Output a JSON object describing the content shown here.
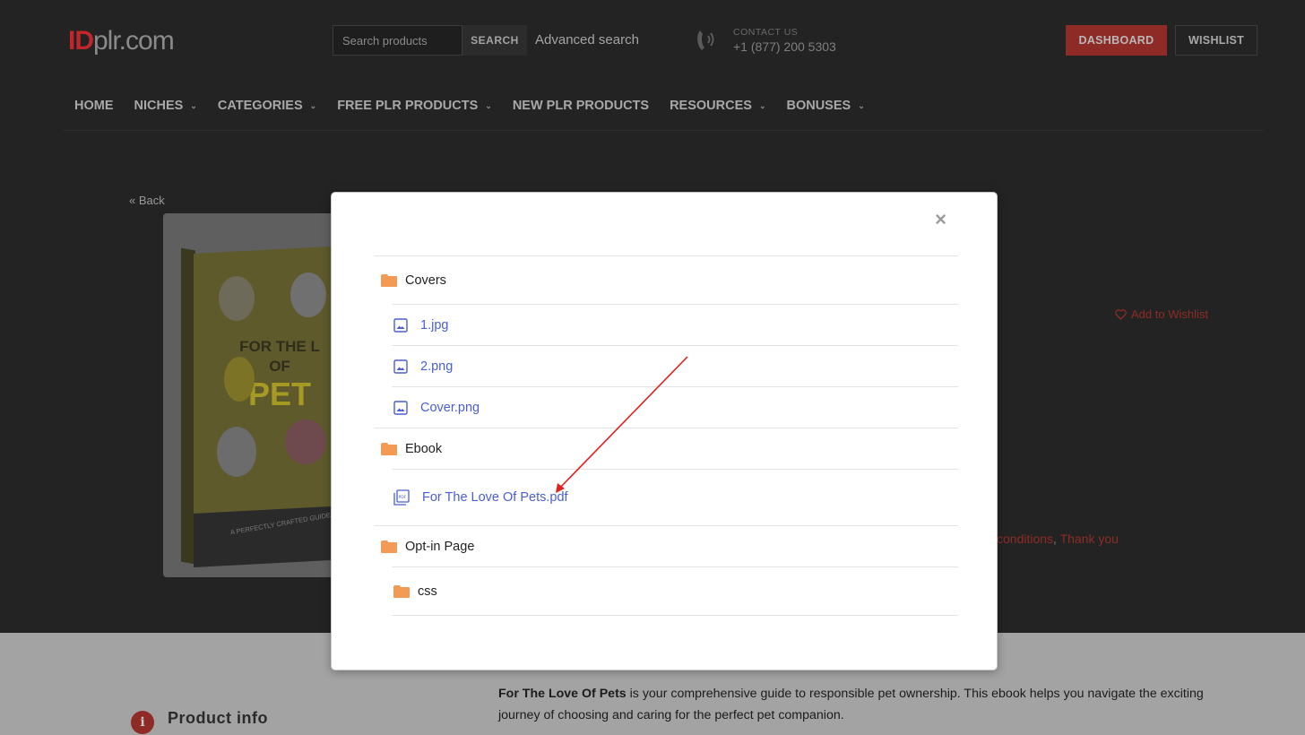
{
  "header": {
    "logo_id": "ID",
    "logo_rest": "plr.com",
    "search_placeholder": "Search products",
    "search_button": "SEARCH",
    "advanced_search": "Advanced search",
    "contact_label": "CONTACT US",
    "contact_number": "+1 (877) 200 5303",
    "dashboard_button": "DASHBOARD",
    "wishlist_button": "WISHLIST"
  },
  "nav": {
    "items": [
      {
        "label": "HOME",
        "dropdown": false
      },
      {
        "label": "NICHES",
        "dropdown": true
      },
      {
        "label": "CATEGORIES",
        "dropdown": true
      },
      {
        "label": "FREE PLR PRODUCTS",
        "dropdown": true
      },
      {
        "label": "NEW PLR PRODUCTS",
        "dropdown": false
      },
      {
        "label": "RESOURCES",
        "dropdown": true
      },
      {
        "label": "BONUSES",
        "dropdown": true
      }
    ]
  },
  "page": {
    "back_link": "« Back",
    "add_to_wishlist": "Add to Wishlist",
    "terms_link_1": "conditions",
    "terms_sep": ",",
    "terms_link_2": "Thank you",
    "product_info_label": "Product info",
    "info_icon_glyph": "i",
    "description_bold": "For The Love Of Pets",
    "description_rest": " is your comprehensive guide to responsible pet ownership. This ebook helps you navigate the exciting journey of choosing and caring for the perfect pet companion.",
    "book": {
      "title_top": "FOR THE L",
      "title_mid": "OF",
      "title_big": "PET",
      "tagline": "A PERFECTLY CRAFTED GUIDE AIME"
    }
  },
  "modal": {
    "close_glyph": "×",
    "tree": [
      {
        "type": "folder",
        "name": "Covers",
        "icon": "folder-icon"
      },
      {
        "type": "file",
        "name": "1.jpg",
        "icon": "image-icon"
      },
      {
        "type": "file",
        "name": "2.png",
        "icon": "image-icon"
      },
      {
        "type": "file",
        "name": "Cover.png",
        "icon": "image-icon"
      },
      {
        "type": "folder",
        "name": "Ebook",
        "icon": "folder-icon"
      },
      {
        "type": "file",
        "name": "For The Love Of Pets.pdf",
        "icon": "pdf-icon"
      },
      {
        "type": "folder",
        "name": "Opt-in Page",
        "icon": "folder-icon"
      },
      {
        "type": "subfolder",
        "name": "css",
        "icon": "folder-icon"
      }
    ]
  },
  "colors": {
    "accent_red": "#c0262b",
    "link_blue": "#4a5ed2",
    "folder_orange": "#f39a55",
    "annotation_arrow": "#e0201d"
  }
}
